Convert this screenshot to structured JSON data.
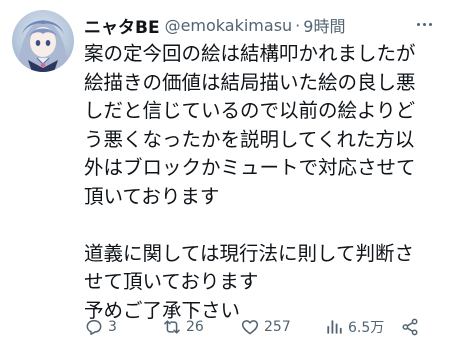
{
  "tweet": {
    "display_name": "ニャタBE",
    "handle": "@emokakimasu",
    "separator": "·",
    "time": "9時間",
    "lines": [
      "案の定今回の絵は結構叩かれましたが",
      "絵描きの価値は結局描いた絵の良し悪",
      "しだと信じているので以前の絵よりど",
      "う悪くなったかを説明してくれた方以",
      "外はブロックかミュートで対応させて",
      "頂いております",
      "",
      "道義に関しては現行法に則して判断さ",
      "せて頂いております",
      "予めご了承下さい"
    ],
    "avatar_icon": "anime-character-avatar",
    "more_icon": "more-options-icon"
  },
  "actions": {
    "reply_count": "3",
    "retweet_count": "26",
    "like_count": "257",
    "view_count": "6.5万",
    "share_icon": "share-icon"
  },
  "colors": {
    "text": "#0f1419",
    "secondary": "#536471",
    "background": "#ffffff"
  }
}
